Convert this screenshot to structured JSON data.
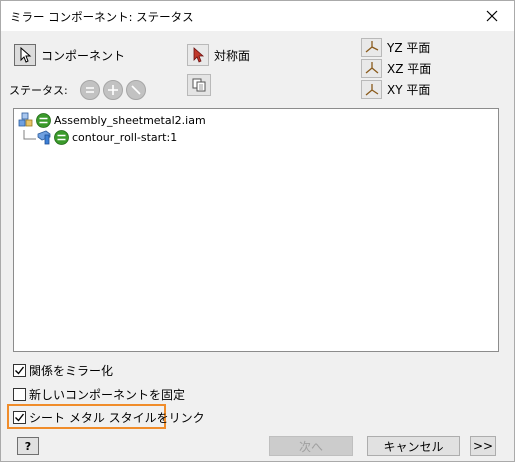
{
  "window": {
    "title": "ミラー コンポーネント: ステータス"
  },
  "toolbar": {
    "component_label": "コンポーネント",
    "symmetry_plane_label": "対称面",
    "status_label": "ステータス:"
  },
  "planes": [
    {
      "label": "YZ 平面"
    },
    {
      "label": "XZ 平面"
    },
    {
      "label": "XY 平面"
    }
  ],
  "tree": {
    "root": {
      "label": "Assembly_sheetmetal2.iam"
    },
    "child": {
      "label": "contour_roll-start:1"
    }
  },
  "options": [
    {
      "label": "関係をミラー化",
      "checked": true
    },
    {
      "label": "新しいコンポーネントを固定",
      "checked": false
    },
    {
      "label": "シート メタル スタイルをリンク",
      "checked": true
    }
  ],
  "footer": {
    "help_label": "?",
    "next_label": "次へ",
    "cancel_label": "キャンセル",
    "more_label": ">>"
  },
  "colors": {
    "highlight_border": "#f08c2a",
    "status_green": "#3a9a2b",
    "arrow_red": "#c0392b",
    "part_blue": "#3d7fd6"
  }
}
